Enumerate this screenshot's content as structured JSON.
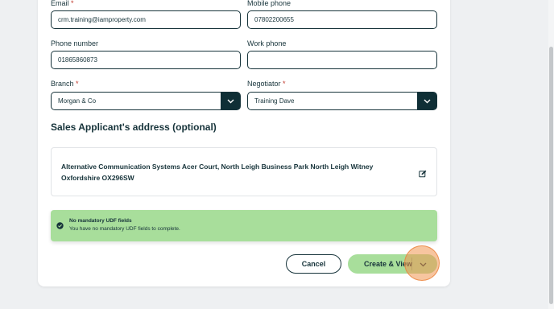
{
  "form": {
    "email": {
      "label": "Email",
      "value": "crm.training@iamproperty.com"
    },
    "mobile_phone": {
      "label": "Mobile phone",
      "value": "07802200655"
    },
    "phone_number": {
      "label": "Phone number",
      "value": "01865860873"
    },
    "work_phone": {
      "label": "Work phone",
      "value": ""
    },
    "branch": {
      "label": "Branch",
      "value": "Morgan & Co"
    },
    "negotiator": {
      "label": "Negotiator",
      "value": "Training Dave"
    },
    "required_marker": "*"
  },
  "address": {
    "title": "Sales Applicant's address (optional)",
    "text": "Alternative Communication Systems Acer Court, North Leigh Business Park North Leigh Witney Oxfordshire OX296SW",
    "edit_icon": "edit-icon"
  },
  "udf": {
    "title": "No mandatory UDF fields",
    "message": "You have no mandatory UDF fields to complete.",
    "icon": "check-circle-icon",
    "color": "#a8de9b"
  },
  "actions": {
    "cancel_label": "Cancel",
    "create_label": "Create & View"
  },
  "colors": {
    "accent": "#0f2f36",
    "success": "#a8de9b",
    "click_highlight": "#f0a060"
  }
}
